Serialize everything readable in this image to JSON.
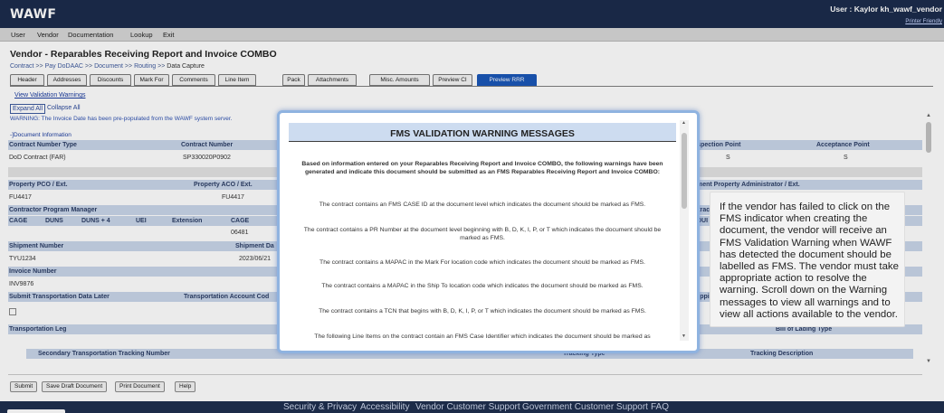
{
  "app": {
    "logo": "WAWF",
    "user_info": "User : Kaylor kh_wawf_vendor",
    "printer_friendly": "Printer Friendly"
  },
  "menu": [
    "User",
    "Vendor",
    "Documentation",
    "Lookup",
    "Exit"
  ],
  "page": {
    "title": "Vendor - Reparables Receiving Report and Invoice COMBO",
    "breadcrumb": {
      "contract": "Contract",
      "pay": "Pay DoDAAC",
      "document": "Document",
      "routing": "Routing",
      "current": "Data Capture",
      "separator": ">>"
    }
  },
  "tabs": [
    "Header",
    "Addresses",
    "Discounts",
    "Mark For",
    "Comments",
    "Line Item",
    "Pack",
    "Attachments",
    "Misc. Amounts",
    "Preview CI",
    "Preview RRR"
  ],
  "active_tab": "Preview RRR",
  "links": {
    "view_validation_warnings": "View Validation Warnings",
    "expand_all": "Expand All",
    "collapse_all": "Collapse All"
  },
  "warning_text": "WARNING: The Invoice Date has been pre-populated from the WAWF system server.",
  "section": "-]Document Information",
  "form": {
    "contract_number_type_label": "Contract Number Type",
    "contract_number_type_value": "DoD Contract (FAR)",
    "contract_number_label": "Contract Number",
    "contract_number_value": "SP330020P0902",
    "inspection_point_label": "Inspection Point",
    "inspection_point_value": "S",
    "acceptance_point_label": "Acceptance Point",
    "acceptance_point_value": "S",
    "property_pco_label": "Property PCO / Ext.",
    "property_pco_value": "FU4417",
    "property_aco_label": "Property ACO / Ext.",
    "property_aco_value": "FU4417",
    "gov_prop_admin_label": "rnment Property Administrator / Ext.",
    "contractor_program_manager_label": "Contractor Program Manager",
    "contrac_partial": "ntrac",
    "cols": [
      "CAGE",
      "DUNS",
      "DUNS + 4",
      "UEI",
      "Extension",
      "CAGE"
    ],
    "dui_partial": "DUI",
    "cage_partial_value": "06481",
    "shipment_number_label": "Shipment Number",
    "shipment_number_value": "TYU1234",
    "shipment_date_label": "Shipment Da",
    "shipment_date_value": "2023/06/21",
    "invoice_number_label": "Invoice Number",
    "invoice_number_value": "INV9876",
    "submit_transport_later_label": "Submit Transportation Data Later",
    "transport_account_code_label": "Transportation Account Cod",
    "shipp_partial": "hippi",
    "transportation_leg_label": "Transportation Leg",
    "bill_of_lading_type_label": "Bill of Lading Type",
    "secondary_tracking_label": "Secondary Transportation Tracking Number",
    "tracking_type_label": "Tracking Type",
    "tracking_description_label": "Tracking Description"
  },
  "buttons": [
    "Submit",
    "Save Draft Document",
    "Print Document",
    "Help"
  ],
  "footer": [
    "Security & Privacy",
    "Accessibility",
    "Vendor Customer Support",
    "Government Customer Support",
    "FAQ"
  ],
  "modal": {
    "title": "FMS VALIDATION WARNING MESSAGES",
    "intro": "Based on information entered on your Reparables Receiving Report and Invoice COMBO, the following warnings have been generated and indicate this document should be submitted as an FMS Reparables Receiving Report and Invoice COMBO:",
    "messages": [
      "The contract contains an FMS CASE ID at the document level which indicates the document should be marked as FMS.",
      "The contract contains a PR Number at the document level beginning with B, D, K, I, P, or T which indicates the document should be marked as FMS.",
      "The contract contains a MAPAC in the Mark For location code which indicates the document should be marked as FMS.",
      "The contract contains a MAPAC in the Ship To location code which indicates the document should be marked as FMS.",
      "The contract contains a TCN that begins with B, D, K, I, P, or T which indicates the document should be marked as FMS.",
      "The following Line Items on the contract contain an FMS Case Identifier which indicates the document should be marked as"
    ]
  },
  "callout": {
    "text": "If the vendor has failed to click on the FMS indicator when creating the document, the vendor will receive an FMS Validation Warning when WAWF has detected the document should be labelled as FMS. The vendor must take appropriate action to resolve the warning. Scroll down on the Warning messages to view all warnings and to view all actions available to the vendor."
  },
  "colors": {
    "topbar": "#1c2c4c",
    "active_tab": "#1b57b8",
    "header_cell": "#c9d6ea",
    "modal_border": "#8fb3e0"
  }
}
